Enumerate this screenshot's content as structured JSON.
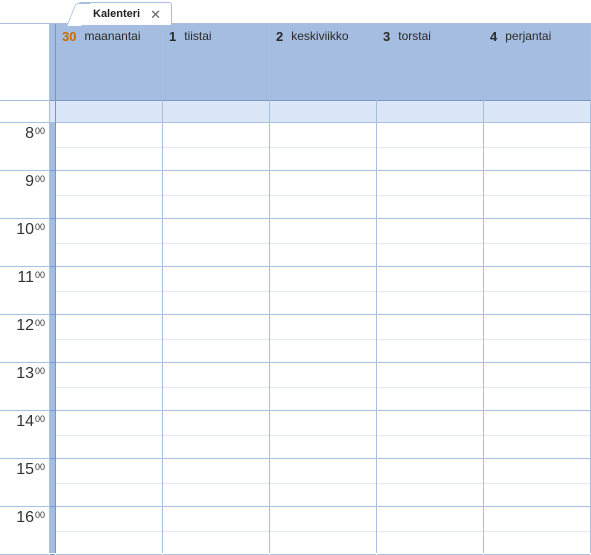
{
  "tab": {
    "title": "Kalenteri",
    "close_glyph": "✕"
  },
  "days": [
    {
      "num": "30",
      "name": "maanantai",
      "today": true
    },
    {
      "num": "1",
      "name": "tiistai",
      "today": false
    },
    {
      "num": "2",
      "name": "keskiviikko",
      "today": false
    },
    {
      "num": "3",
      "name": "torstai",
      "today": false
    },
    {
      "num": "4",
      "name": "perjantai",
      "today": false
    }
  ],
  "hours": [
    {
      "hour": "8",
      "minute": "00"
    },
    {
      "hour": "9",
      "minute": "00"
    },
    {
      "hour": "10",
      "minute": "00"
    },
    {
      "hour": "11",
      "minute": "00"
    },
    {
      "hour": "12",
      "minute": "00"
    },
    {
      "hour": "13",
      "minute": "00"
    },
    {
      "hour": "14",
      "minute": "00"
    },
    {
      "hour": "15",
      "minute": "00"
    },
    {
      "hour": "16",
      "minute": "00"
    }
  ]
}
